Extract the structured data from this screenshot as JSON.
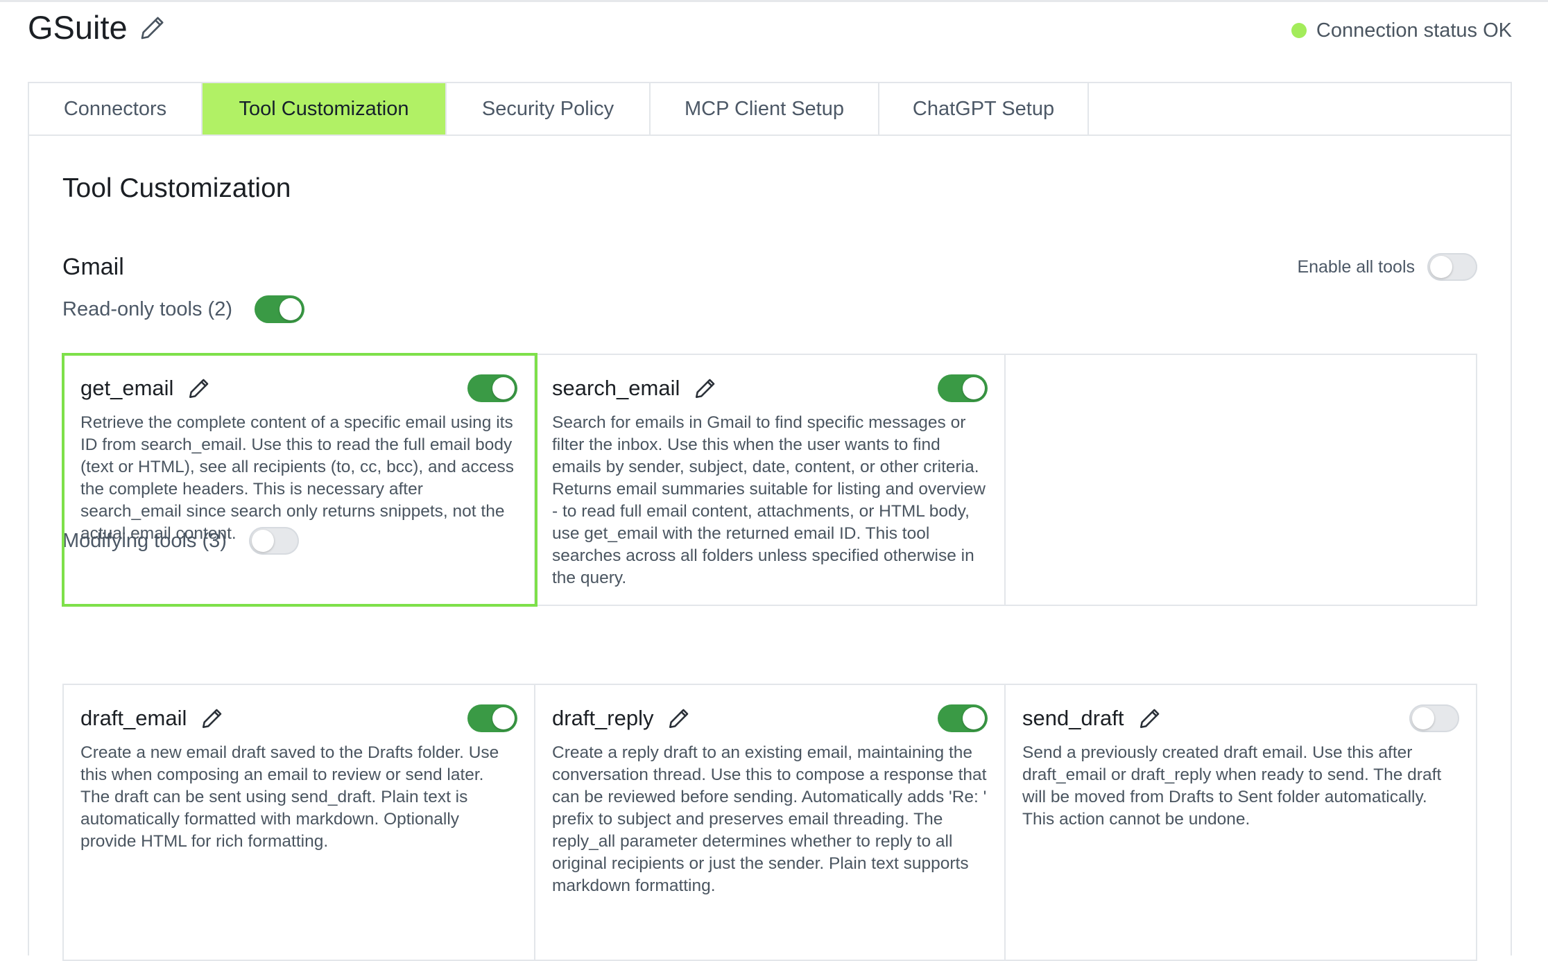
{
  "header": {
    "title": "GSuite",
    "status_text": "Connection status OK",
    "status_color": "#a3ec5a"
  },
  "tabs": [
    {
      "label": "Connectors",
      "active": false
    },
    {
      "label": "Tool Customization",
      "active": true
    },
    {
      "label": "Security Policy",
      "active": false
    },
    {
      "label": "MCP Client Setup",
      "active": false
    },
    {
      "label": "ChatGPT Setup",
      "active": false
    }
  ],
  "main": {
    "section_title": "Tool Customization",
    "group": {
      "title": "Gmail",
      "enable_all_label": "Enable all tools",
      "enable_all_on": false
    },
    "read_only": {
      "label": "Read-only tools (2)",
      "enabled": true,
      "tools": [
        {
          "name": "get_email",
          "enabled": true,
          "selected": true,
          "description": "Retrieve the complete content of a specific email using its ID from search_email. Use this to read the full email body (text or HTML), see all recipients (to, cc, bcc), and access the complete headers. This is necessary after search_email since search only returns snippets, not the actual email content."
        },
        {
          "name": "search_email",
          "enabled": true,
          "selected": false,
          "description": "Search for emails in Gmail to find specific messages or filter the inbox. Use this when the user wants to find emails by sender, subject, date, content, or other criteria. Returns email summaries suitable for listing and overview - to read full email content, attachments, or HTML body, use get_email with the returned email ID. This tool searches across all folders unless specified otherwise in the query."
        }
      ]
    },
    "modifying": {
      "label": "Modifying tools (3)",
      "enabled": false,
      "tools": [
        {
          "name": "draft_email",
          "enabled": true,
          "description": "Create a new email draft saved to the Drafts folder. Use this when composing an email to review or send later. The draft can be sent using send_draft. Plain text is automatically formatted with markdown. Optionally provide HTML for rich formatting."
        },
        {
          "name": "draft_reply",
          "enabled": true,
          "description": "Create a reply draft to an existing email, maintaining the conversation thread. Use this to compose a response that can be reviewed before sending. Automatically adds 'Re: ' prefix to subject and preserves email threading. The reply_all parameter determines whether to reply to all original recipients or just the sender. Plain text supports markdown formatting."
        },
        {
          "name": "send_draft",
          "enabled": false,
          "description": "Send a previously created draft email. Use this after draft_email or draft_reply when ready to send. The draft will be moved from Drafts to Sent folder automatically. This action cannot be undone."
        }
      ]
    }
  },
  "colors": {
    "accent": "#b1f165",
    "toggle_on": "#3a9a45",
    "selected_outline": "#7ee04a"
  },
  "icons": {
    "edit": "pencil-icon",
    "status": "status-dot-icon"
  }
}
